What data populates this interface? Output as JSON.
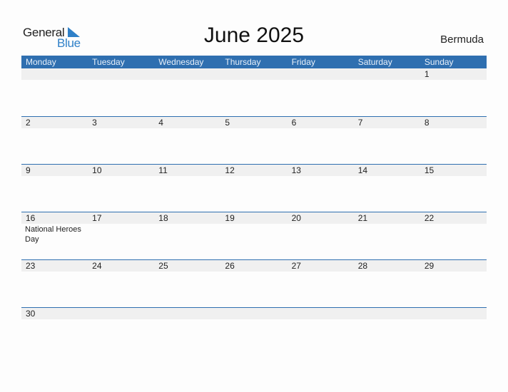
{
  "logo": {
    "general": "General",
    "blue": "Blue"
  },
  "title": "June 2025",
  "country": "Bermuda",
  "colors": {
    "accent": "#2f6fb0",
    "logo_blue": "#2f80c8",
    "row_bg": "#f0f0f0"
  },
  "weekdays": [
    "Monday",
    "Tuesday",
    "Wednesday",
    "Thursday",
    "Friday",
    "Saturday",
    "Sunday"
  ],
  "weeks": [
    {
      "days": [
        "",
        "",
        "",
        "",
        "",
        "",
        "1"
      ],
      "events": [
        "",
        "",
        "",
        "",
        "",
        "",
        ""
      ]
    },
    {
      "days": [
        "2",
        "3",
        "4",
        "5",
        "6",
        "7",
        "8"
      ],
      "events": [
        "",
        "",
        "",
        "",
        "",
        "",
        ""
      ]
    },
    {
      "days": [
        "9",
        "10",
        "11",
        "12",
        "13",
        "14",
        "15"
      ],
      "events": [
        "",
        "",
        "",
        "",
        "",
        "",
        ""
      ]
    },
    {
      "days": [
        "16",
        "17",
        "18",
        "19",
        "20",
        "21",
        "22"
      ],
      "events": [
        "National Heroes Day",
        "",
        "",
        "",
        "",
        "",
        ""
      ]
    },
    {
      "days": [
        "23",
        "24",
        "25",
        "26",
        "27",
        "28",
        "29"
      ],
      "events": [
        "",
        "",
        "",
        "",
        "",
        "",
        ""
      ]
    },
    {
      "days": [
        "30",
        "",
        "",
        "",
        "",
        "",
        ""
      ],
      "events": [
        "",
        "",
        "",
        "",
        "",
        "",
        ""
      ]
    }
  ]
}
